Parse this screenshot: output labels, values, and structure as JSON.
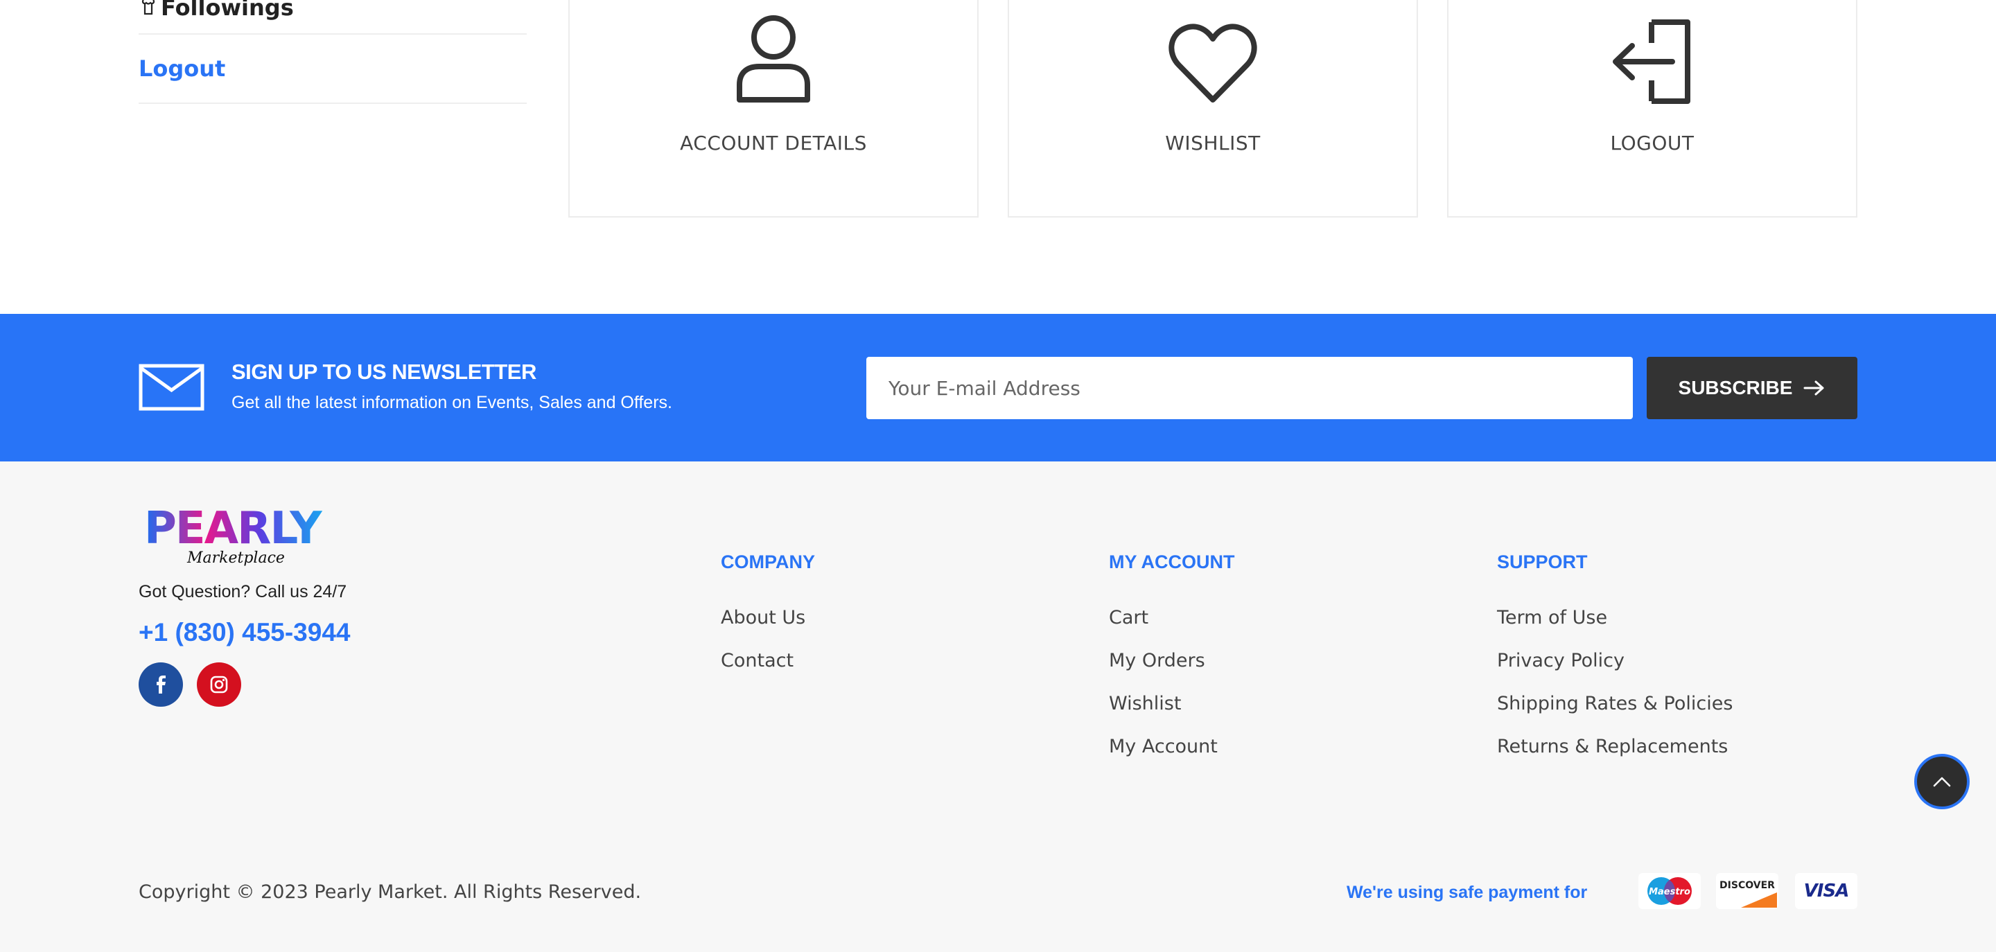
{
  "side_menu": {
    "followings_label": "Followings",
    "logout_label": "Logout"
  },
  "cards": [
    {
      "label": "ACCOUNT DETAILS",
      "icon": "user-icon"
    },
    {
      "label": "WISHLIST",
      "icon": "heart-icon"
    },
    {
      "label": "LOGOUT",
      "icon": "logout-icon"
    }
  ],
  "newsletter": {
    "title": "SIGN UP TO US NEWSLETTER",
    "subtitle": "Get all the latest information on Events, Sales and Offers.",
    "email_placeholder": "Your E-mail Address",
    "subscribe_label": "SUBSCRIBE",
    "background_color": "#2874f7"
  },
  "footer": {
    "logo_text": "PEARLY",
    "logo_script": "Marketplace",
    "question": "Got Question? Call us 24/7",
    "phone": "+1 (830) 455-3944",
    "social": [
      "facebook-icon",
      "instagram-icon"
    ],
    "columns": {
      "company": {
        "title": "COMPANY",
        "links": [
          "About Us",
          "Contact"
        ]
      },
      "account": {
        "title": "MY ACCOUNT",
        "links": [
          "Cart",
          "My Orders",
          "Wishlist",
          "My Account"
        ]
      },
      "support": {
        "title": "SUPPORT",
        "links": [
          "Term of Use",
          "Privacy Policy",
          "Shipping Rates & Policies",
          "Returns & Replacements"
        ]
      }
    },
    "copyright": "Copyright © 2023 Pearly Market. All Rights Reserved.",
    "safe_payment": "We're using safe payment for",
    "payment_methods": {
      "maestro": "Maestro",
      "discover": "DISCOVER",
      "visa": "VISA"
    }
  },
  "colors": {
    "accent": "#2a74f5",
    "dark": "#333333",
    "footer_bg": "#f7f7f7"
  }
}
